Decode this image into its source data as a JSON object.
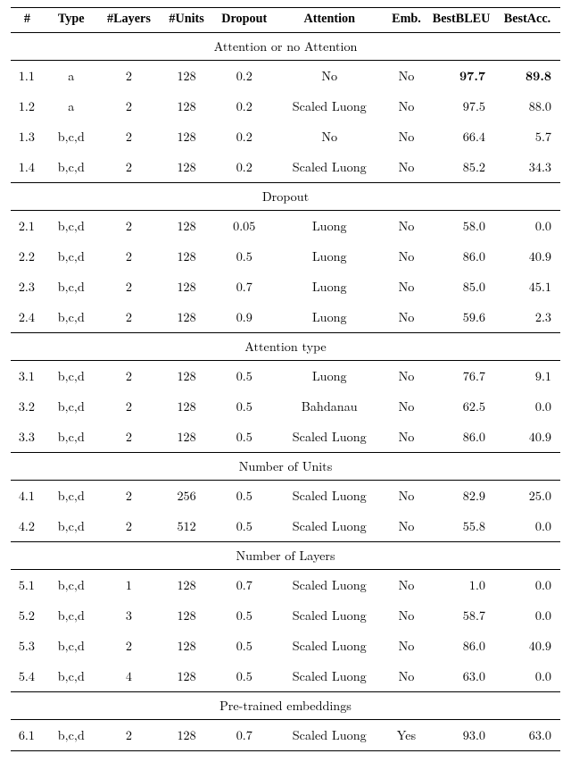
{
  "headers": {
    "num": "#",
    "type": "Type",
    "layers": "#Layers",
    "units": "#Units",
    "dropout": "Dropout",
    "attention": "Attention",
    "emb": "Emb.",
    "bleu": "BestBLEU",
    "acc": "BestAcc."
  },
  "chart_data": {
    "type": "table",
    "title": "",
    "columns": [
      "#",
      "Type",
      "#Layers",
      "#Units",
      "Dropout",
      "Attention",
      "Emb.",
      "BestBLEU",
      "BestAcc."
    ],
    "sections": [
      {
        "title": "Attention or no Attention",
        "rows": [
          {
            "num": "1.1",
            "type": "a",
            "layers": "2",
            "units": "128",
            "dropout": "0.2",
            "attention": "No",
            "emb": "No",
            "bleu": "97.7",
            "acc": "89.8",
            "bold": true
          },
          {
            "num": "1.2",
            "type": "a",
            "layers": "2",
            "units": "128",
            "dropout": "0.2",
            "attention": "Scaled Luong",
            "emb": "No",
            "bleu": "97.5",
            "acc": "88.0"
          },
          {
            "num": "1.3",
            "type": "b,c,d",
            "layers": "2",
            "units": "128",
            "dropout": "0.2",
            "attention": "No",
            "emb": "No",
            "bleu": "66.4",
            "acc": "5.7"
          },
          {
            "num": "1.4",
            "type": "b,c,d",
            "layers": "2",
            "units": "128",
            "dropout": "0.2",
            "attention": "Scaled Luong",
            "emb": "No",
            "bleu": "85.2",
            "acc": "34.3"
          }
        ]
      },
      {
        "title": "Dropout",
        "rows": [
          {
            "num": "2.1",
            "type": "b,c,d",
            "layers": "2",
            "units": "128",
            "dropout": "0.05",
            "attention": "Luong",
            "emb": "No",
            "bleu": "58.0",
            "acc": "0.0"
          },
          {
            "num": "2.2",
            "type": "b,c,d",
            "layers": "2",
            "units": "128",
            "dropout": "0.5",
            "attention": "Luong",
            "emb": "No",
            "bleu": "86.0",
            "acc": "40.9"
          },
          {
            "num": "2.3",
            "type": "b,c,d",
            "layers": "2",
            "units": "128",
            "dropout": "0.7",
            "attention": "Luong",
            "emb": "No",
            "bleu": "85.0",
            "acc": "45.1"
          },
          {
            "num": "2.4",
            "type": "b,c,d",
            "layers": "2",
            "units": "128",
            "dropout": "0.9",
            "attention": "Luong",
            "emb": "No",
            "bleu": "59.6",
            "acc": "2.3"
          }
        ]
      },
      {
        "title": "Attention type",
        "rows": [
          {
            "num": "3.1",
            "type": "b,c,d",
            "layers": "2",
            "units": "128",
            "dropout": "0.5",
            "attention": "Luong",
            "emb": "No",
            "bleu": "76.7",
            "acc": "9.1"
          },
          {
            "num": "3.2",
            "type": "b,c,d",
            "layers": "2",
            "units": "128",
            "dropout": "0.5",
            "attention": "Bahdanau",
            "emb": "No",
            "bleu": "62.5",
            "acc": "0.0"
          },
          {
            "num": "3.3",
            "type": "b,c,d",
            "layers": "2",
            "units": "128",
            "dropout": "0.5",
            "attention": "Scaled Luong",
            "emb": "No",
            "bleu": "86.0",
            "acc": "40.9"
          }
        ]
      },
      {
        "title": "Number of Units",
        "rows": [
          {
            "num": "4.1",
            "type": "b,c,d",
            "layers": "2",
            "units": "256",
            "dropout": "0.5",
            "attention": "Scaled Luong",
            "emb": "No",
            "bleu": "82.9",
            "acc": "25.0"
          },
          {
            "num": "4.2",
            "type": "b,c,d",
            "layers": "2",
            "units": "512",
            "dropout": "0.5",
            "attention": "Scaled Luong",
            "emb": "No",
            "bleu": "55.8",
            "acc": "0.0"
          }
        ]
      },
      {
        "title": "Number of Layers",
        "rows": [
          {
            "num": "5.1",
            "type": "b,c,d",
            "layers": "1",
            "units": "128",
            "dropout": "0.7",
            "attention": "Scaled Luong",
            "emb": "No",
            "bleu": "1.0",
            "acc": "0.0"
          },
          {
            "num": "5.2",
            "type": "b,c,d",
            "layers": "3",
            "units": "128",
            "dropout": "0.5",
            "attention": "Scaled Luong",
            "emb": "No",
            "bleu": "58.7",
            "acc": "0.0"
          },
          {
            "num": "5.3",
            "type": "b,c,d",
            "layers": "2",
            "units": "128",
            "dropout": "0.5",
            "attention": "Scaled Luong",
            "emb": "No",
            "bleu": "86.0",
            "acc": "40.9"
          },
          {
            "num": "5.4",
            "type": "b,c,d",
            "layers": "4",
            "units": "128",
            "dropout": "0.5",
            "attention": "Scaled Luong",
            "emb": "No",
            "bleu": "63.0",
            "acc": "0.0"
          }
        ]
      },
      {
        "title": "Pre-trained embeddings",
        "rows": [
          {
            "num": "6.1",
            "type": "b,c,d",
            "layers": "2",
            "units": "128",
            "dropout": "0.7",
            "attention": "Scaled Luong",
            "emb": "Yes",
            "bleu": "93.0",
            "acc": "63.0"
          }
        ]
      }
    ]
  }
}
